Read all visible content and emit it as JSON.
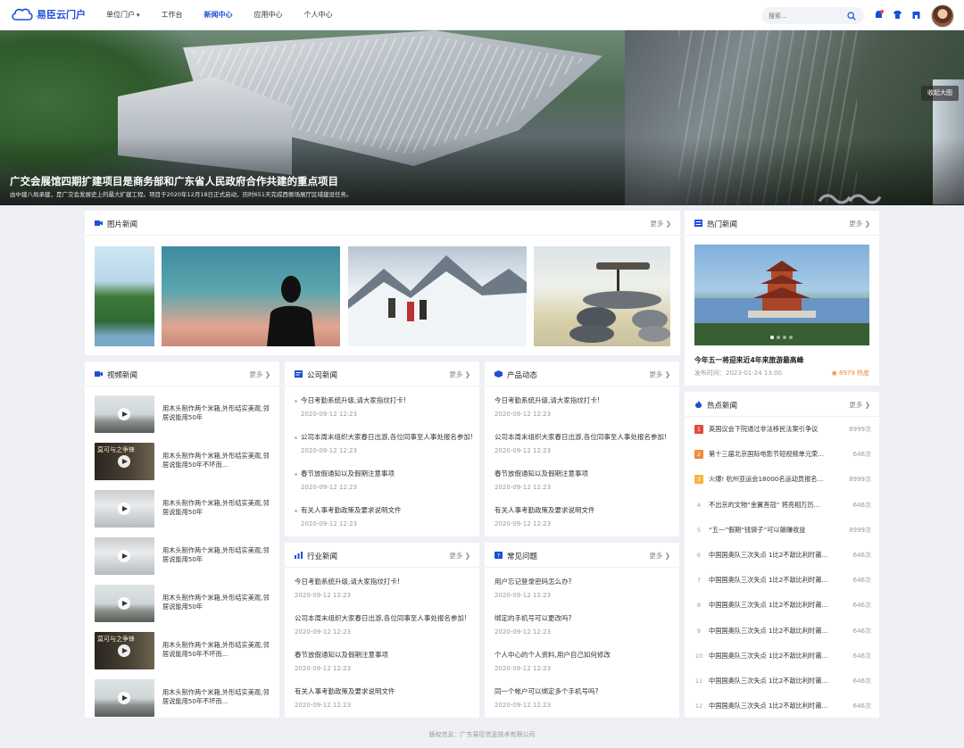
{
  "header": {
    "logo_text": "易臣云门户",
    "nav": [
      {
        "label": "单位门户",
        "caret": "▾"
      },
      {
        "label": "工作台"
      },
      {
        "label": "新闻中心"
      },
      {
        "label": "应用中心"
      },
      {
        "label": "个人中心"
      }
    ],
    "active_nav": "新闻中心",
    "search_placeholder": "搜索..."
  },
  "banner": {
    "title": "广交会展馆四期扩建项目是商务部和广东省人民政府合作共建的重点项目",
    "subtitle": "由中建八局承建，是广交会发展史上的最大扩建工程。项目于2020年12月18日正式启动，历时651天完成西侧场展厅区域建设任务。",
    "collapse_label": "收起大图",
    "slides": 4,
    "active_slide": 1
  },
  "picture_news": {
    "title": "图片新闻",
    "more": "更多 ❯"
  },
  "hot_news": {
    "title": "热门新闻",
    "more": "更多 ❯",
    "headline": "今年五一将迎来近4年来旅游最高峰",
    "date": "发布时间：2023-01-24 13:00",
    "heat": "8979 热度"
  },
  "video_news": {
    "title": "视频新闻",
    "more": "更多 ❯",
    "items": [
      {
        "text": "用木头制作两个米箱,外形结实美观,邻居说能用50年"
      },
      {
        "text": "用木头制作两个米箱,外形结实美观,邻居说能用50年不坏而..."
      },
      {
        "text": "用木头制作两个米箱,外形结实美观,邻居说能用50年"
      },
      {
        "text": "用木头制作两个米箱,外形结实美观,邻居说能用50年"
      },
      {
        "text": "用木头制作两个米箱,外形结实美观,邻居说能用50年"
      },
      {
        "text": "用木头制作两个米箱,外形结实美观,邻居说能用50年不坏而..."
      },
      {
        "text": "用木头制作两个米箱,外形结实美观,邻居说能用50年不坏而..."
      }
    ],
    "thumb_caption": "莫可与之争锋"
  },
  "company_news": {
    "title": "公司新闻",
    "more": "更多 ❯",
    "items": [
      {
        "t": "今日考勤系统升级,请大家指纹打卡!",
        "d": "2020-09-12 12:23"
      },
      {
        "t": "公司本周末组织大家春日出游,各位同事至人事处报名参加!",
        "d": "2020-09-12 12:23"
      },
      {
        "t": "春节放假通知以及假期注意事项",
        "d": "2020-09-12 12:23"
      },
      {
        "t": "有关人事考勤政策及要求说明文件",
        "d": "2020-09-12 12:23"
      }
    ]
  },
  "product_news": {
    "title": "产品动态",
    "more": "更多 ❯",
    "items": [
      {
        "t": "今日考勤系统升级,请大家指纹打卡!",
        "d": "2020-09-12 12:23"
      },
      {
        "t": "公司本周末组织大家春日出游,各位同事至人事处报名参加!",
        "d": "2020-09-12 12:23"
      },
      {
        "t": "春节放假通知以及假期注意事项",
        "d": "2020-09-12 12:23"
      },
      {
        "t": "有关人事考勤政策及要求说明文件",
        "d": "2020-09-12 12:23"
      }
    ]
  },
  "industry_news": {
    "title": "行业新闻",
    "more": "更多 ❯",
    "items": [
      {
        "t": "今日考勤系统升级,请大家指纹打卡!",
        "d": "2020-09-12 12:23"
      },
      {
        "t": "公司本周末组织大家春日出游,各位同事至人事处报名参加!",
        "d": "2020-09-12 12:23"
      },
      {
        "t": "春节放假通知以及假期注意事项",
        "d": "2020-09-12 12:23"
      },
      {
        "t": "有关人事考勤政策及要求说明文件",
        "d": "2020-09-12 12:23"
      }
    ]
  },
  "faq": {
    "title": "常见问题",
    "more": "更多 ❯",
    "items": [
      {
        "t": "用户忘记登录密码怎么办?",
        "d": "2020-09-12 12:23"
      },
      {
        "t": "绑定的手机号可以更改吗?",
        "d": "2020-09-12 12:23"
      },
      {
        "t": "个人中心的个人资料,用户自己如何修改",
        "d": "2020-09-12 12:23"
      },
      {
        "t": "同一个帐户可以绑定多个手机号吗?",
        "d": "2020-09-12 12:23"
      }
    ]
  },
  "hotspot": {
    "title": "热点新闻",
    "more": "更多 ❯",
    "items": [
      {
        "rank": "1",
        "t": "英国议会下院通过非法移民法案引争议",
        "c": "8999次"
      },
      {
        "rank": "2",
        "t": "第十三届北京国际电影节短视频单元荣...",
        "c": "646次"
      },
      {
        "rank": "3",
        "t": "火爆! 杭州亚运会18000名运动员报名...",
        "c": "8999次"
      },
      {
        "rank": "4",
        "t": "不出京的文物“金翼善冠” 将亮相万历...",
        "c": "646次"
      },
      {
        "rank": "5",
        "t": "“五一”假期“钱袋子”可以躺赚收益",
        "c": "8999次"
      },
      {
        "rank": "6",
        "t": "中国国奥队三次失点 1比2不敌比利时莆...",
        "c": "646次"
      },
      {
        "rank": "7",
        "t": "中国国奥队三次失点 1比2不敌比利时莆...",
        "c": "646次"
      },
      {
        "rank": "8",
        "t": "中国国奥队三次失点 1比2不敌比利时莆...",
        "c": "646次"
      },
      {
        "rank": "9",
        "t": "中国国奥队三次失点 1比2不敌比利时莆...",
        "c": "646次"
      },
      {
        "rank": "10",
        "t": "中国国奥队三次失点 1比2不敌比利时莆...",
        "c": "646次"
      },
      {
        "rank": "11",
        "t": "中国国奥队三次失点 1比2不敌比利时莆...",
        "c": "646次"
      },
      {
        "rank": "12",
        "t": "中国国奥队三次失点 1比2不敌比利时莆...",
        "c": "646次"
      }
    ]
  },
  "footer": "版权信息：广东易臣信息技术有限公司",
  "colors": {
    "brand": "#1d4ed8",
    "rank1": "#e5483a",
    "rank2": "#f08a3c",
    "rank3": "#f5b43a",
    "heat": "#f08a3c"
  }
}
